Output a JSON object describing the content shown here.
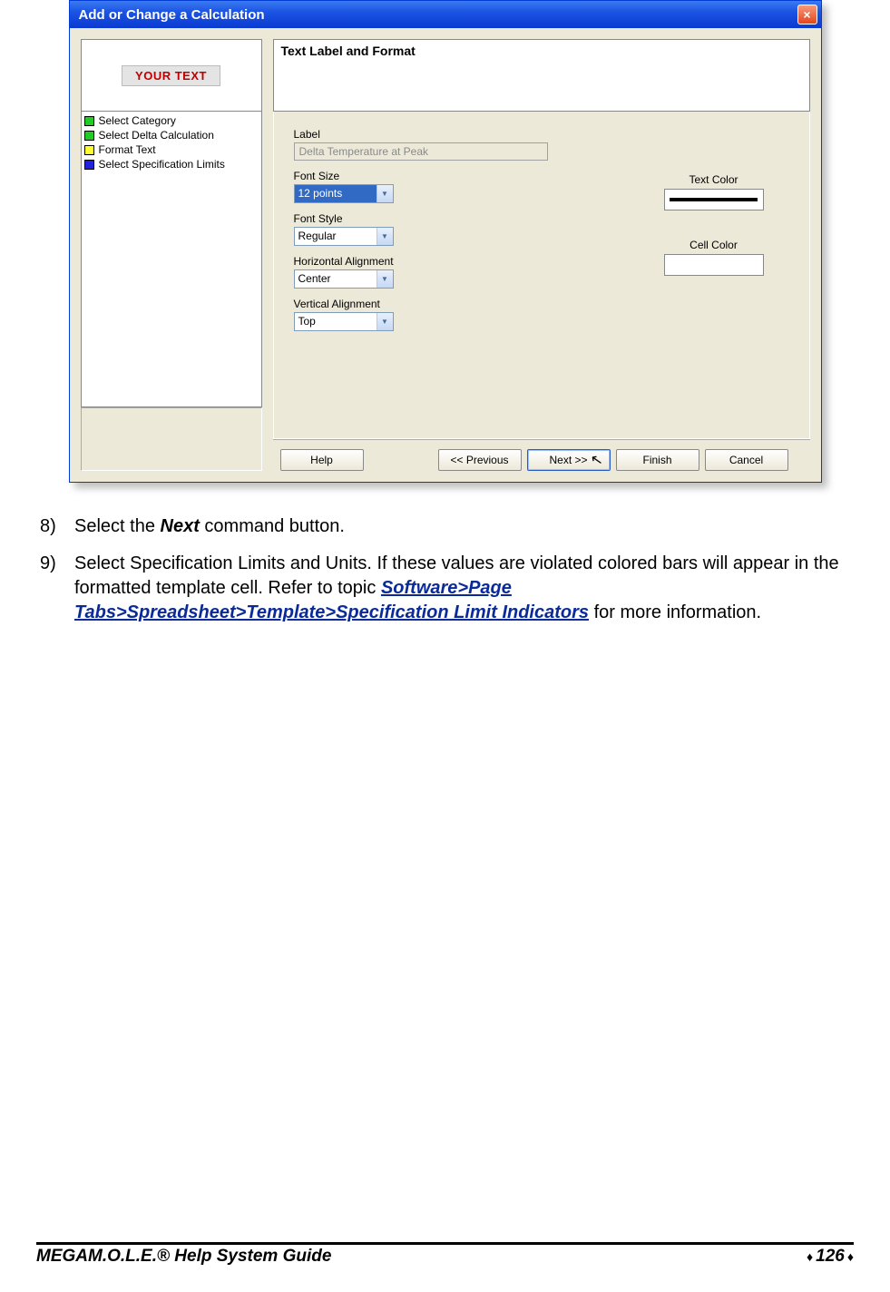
{
  "dialog": {
    "title": "Add or Change a Calculation",
    "close": "×",
    "preview_text": "YOUR TEXT",
    "steps": [
      {
        "color": "#22cc22",
        "label": "Select Category"
      },
      {
        "color": "#22cc22",
        "label": "Select Delta Calculation"
      },
      {
        "color": "#ffff33",
        "label": "Format Text"
      },
      {
        "color": "#2222dd",
        "label": "Select Specification Limits"
      }
    ],
    "heading": "Text Label and Format",
    "fields": {
      "label_label": "Label",
      "label_value": "Delta Temperature at Peak",
      "fontsize_label": "Font Size",
      "fontsize_value": "12 points",
      "fontstyle_label": "Font Style",
      "fontstyle_value": "Regular",
      "halign_label": "Horizontal Alignment",
      "halign_value": "Center",
      "valign_label": "Vertical Alignment",
      "valign_value": "Top",
      "textcolor_label": "Text Color",
      "cellcolor_label": "Cell Color"
    },
    "buttons": {
      "help": "Help",
      "prev": "<< Previous",
      "next": "Next >>",
      "finish": "Finish",
      "cancel": "Cancel"
    }
  },
  "instructions": {
    "item8_num": "8)",
    "item8_a": "Select the ",
    "item8_b": "Next",
    "item8_c": " command button.",
    "item9_num": "9)",
    "item9_a": "Select Specification Limits and Units. If these values are violated colored bars will appear in the formatted template cell. Refer to  topic ",
    "item9_link": "Software>Page Tabs>Spreadsheet>Template>Specification Limit Indicators",
    "item9_b": " for more information."
  },
  "footer": {
    "brand_bold": "MEGA",
    "brand_rest": "M.O.L.E.® Help System Guide",
    "page": "126"
  }
}
